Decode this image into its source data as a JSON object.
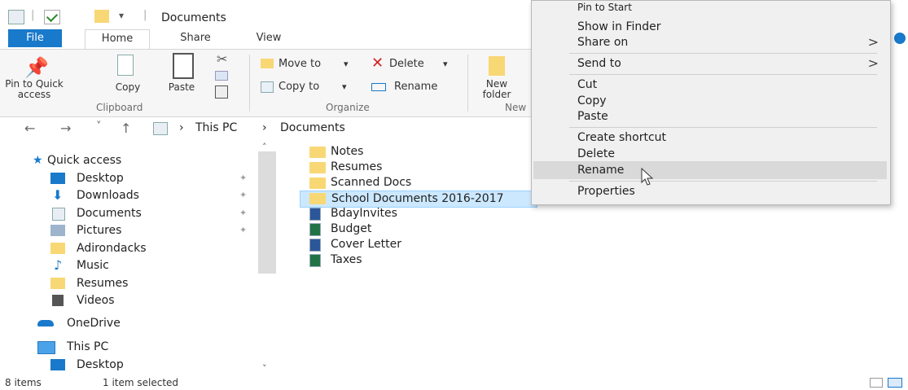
{
  "window": {
    "title": "Documents",
    "qa_separator": "|",
    "qa_dropdown": "▾"
  },
  "ribbon": {
    "tabs": [
      "File",
      "Home",
      "Share",
      "View"
    ],
    "clipboard": {
      "pin_label": "Pin to Quick access",
      "copy_label": "Copy",
      "paste_label": "Paste",
      "group_label": "Clipboard"
    },
    "organize": {
      "move_to": "Move to",
      "delete": "Delete",
      "copy_to": "Copy to",
      "rename": "Rename",
      "group_label": "Organize"
    },
    "new": {
      "new_folder": "New folder",
      "group_label": "New"
    },
    "dropdown_arrow": "▾"
  },
  "address": {
    "back": "←",
    "forward": "→",
    "recent": "˅",
    "up": "↑",
    "crumbs": [
      "This PC",
      "Documents"
    ],
    "crumb_sep": "›"
  },
  "nav": {
    "items": [
      {
        "label": "Quick access",
        "icon": "star-icon",
        "pinned": false
      },
      {
        "label": "Desktop",
        "icon": "desktop-icon",
        "pinned": true
      },
      {
        "label": "Downloads",
        "icon": "download-arrow-icon",
        "pinned": true
      },
      {
        "label": "Documents",
        "icon": "documents-icon",
        "pinned": true
      },
      {
        "label": "Pictures",
        "icon": "pictures-icon",
        "pinned": true
      },
      {
        "label": "Adirondacks",
        "icon": "folder-icon",
        "pinned": false
      },
      {
        "label": "Music",
        "icon": "music-note-icon",
        "pinned": false
      },
      {
        "label": "Resumes",
        "icon": "folder-icon",
        "pinned": false
      },
      {
        "label": "Videos",
        "icon": "videos-icon",
        "pinned": false
      },
      {
        "label": "OneDrive",
        "icon": "cloud-icon",
        "pinned": false
      },
      {
        "label": "This PC",
        "icon": "computer-icon",
        "pinned": false
      },
      {
        "label": "Desktop",
        "icon": "desktop-icon",
        "pinned": false
      }
    ],
    "pin_glyph": "✦"
  },
  "files": [
    {
      "name": "Notes",
      "type": "folder",
      "selected": false
    },
    {
      "name": "Resumes",
      "type": "folder",
      "selected": false
    },
    {
      "name": "Scanned Docs",
      "type": "folder",
      "selected": false
    },
    {
      "name": "School Documents 2016-2017",
      "type": "folder",
      "selected": true
    },
    {
      "name": "BdayInvites",
      "type": "word",
      "selected": false
    },
    {
      "name": "Budget",
      "type": "excel",
      "selected": false
    },
    {
      "name": "Cover Letter",
      "type": "word",
      "selected": false
    },
    {
      "name": "Taxes",
      "type": "excel",
      "selected": false
    }
  ],
  "status": {
    "item_count": "8 items",
    "selection": "1 item selected"
  },
  "context_menu": {
    "items": [
      "Pin to Start",
      "Show in Finder",
      "Share on",
      "Send to",
      "Cut",
      "Copy",
      "Paste",
      "Create shortcut",
      "Delete",
      "Rename",
      "Properties"
    ],
    "submenu_arrow": ">",
    "highlighted": "Rename"
  },
  "colors": {
    "accent": "#1979ca",
    "selection_bg": "#cce8ff",
    "folder": "#f8d775",
    "menu_bg": "#f0f0f0",
    "menu_highlight": "#d9d9d9"
  }
}
